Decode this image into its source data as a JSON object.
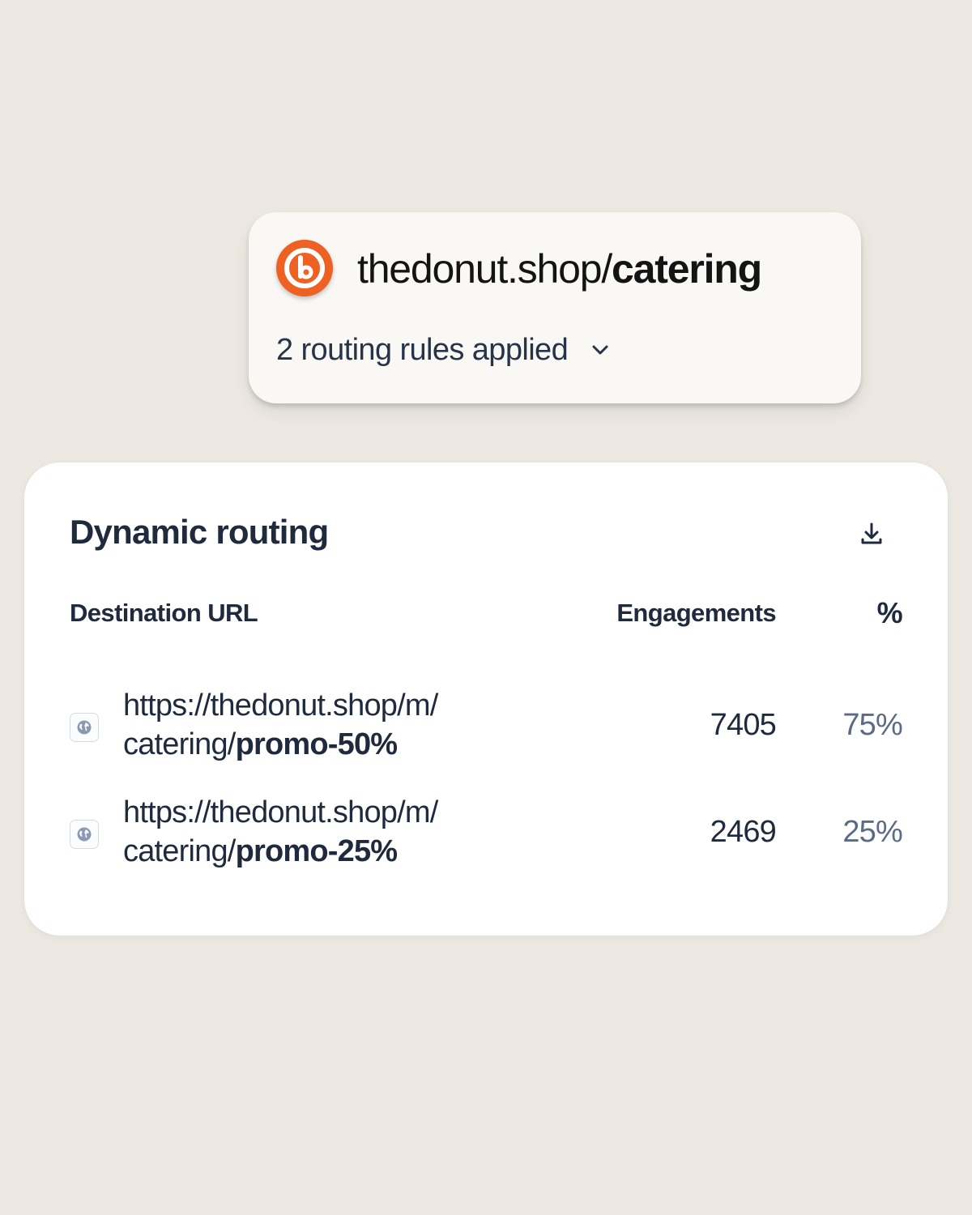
{
  "link_card": {
    "domain": "thedonut.shop/",
    "slug": "catering",
    "rules_label": "2 routing rules applied",
    "logo_icon": "bitly-logo-icon",
    "brand_color": "#ee6123"
  },
  "routing": {
    "title": "Dynamic routing",
    "download_icon": "download-icon",
    "columns": {
      "url": "Destination URL",
      "engagements": "Engagements",
      "percent": "%"
    },
    "rows": [
      {
        "icon": "globe-icon",
        "url_line1": "https://thedonut.shop/m/",
        "url_prefix": "catering/",
        "url_suffix": "promo-50%",
        "engagements": "7405",
        "percent": "75%"
      },
      {
        "icon": "globe-icon",
        "url_line1": "https://thedonut.shop/m/",
        "url_prefix": "catering/",
        "url_suffix": "promo-25%",
        "engagements": "2469",
        "percent": "25%"
      }
    ]
  },
  "colors": {
    "background": "#ede9e2",
    "text_primary": "#1f2a3d",
    "text_muted": "#5b6b84"
  }
}
